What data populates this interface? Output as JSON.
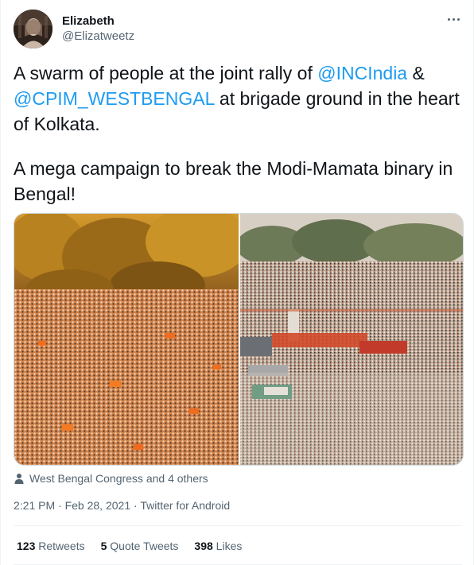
{
  "user": {
    "display_name": "Elizabeth",
    "handle": "@Elizatweetz",
    "avatar_icon": "avatar-photo"
  },
  "more_icon": "ellipsis-icon",
  "body": {
    "p1_part1": "A swarm of people at the joint rally of ",
    "mention1": "@INCIndia",
    "p1_part2": " & ",
    "mention2": "@CPIM_WESTBENGAL",
    "p1_part3": " at brigade ground in the heart of Kolkata.",
    "p2": "A mega campaign to break the Modi-Mamata binary in Bengal!"
  },
  "media": {
    "count": 2,
    "left_photo": "Crowd at rally with trees (warm-toned)",
    "right_photo": "Aerial view of crowd at Brigade Ground with stage"
  },
  "tagged": {
    "icon": "person-icon",
    "text": "West Bengal Congress and 4 others"
  },
  "meta": {
    "time": "2:21 PM",
    "sep1": " · ",
    "date": "Feb 28, 2021",
    "sep2": " · ",
    "source": "Twitter for Android"
  },
  "stats": {
    "retweets_count": "123",
    "retweets_label": " Retweets",
    "quotes_count": "5",
    "quotes_label": " Quote Tweets",
    "likes_count": "398",
    "likes_label": " Likes"
  },
  "colors": {
    "accent": "#1d9bf0",
    "text": "#0f1419",
    "secondary": "#536471",
    "border": "#eff3f4"
  }
}
